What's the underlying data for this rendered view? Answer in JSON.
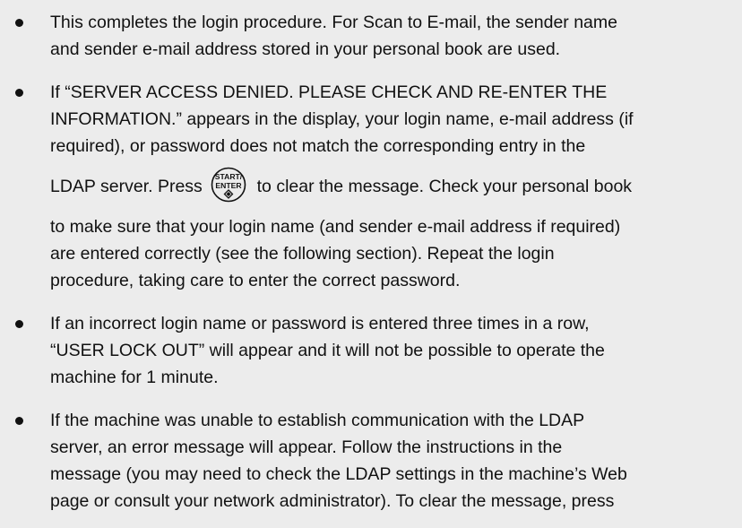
{
  "bullets": [
    {
      "lines": [
        "This completes the login procedure. For Scan to E-mail, the sender name",
        "and sender e-mail address stored in your personal book are used."
      ]
    },
    {
      "lines_before": [
        "If “SERVER ACCESS DENIED. PLEASE CHECK AND RE-ENTER THE",
        "INFORMATION.” appears in the display, your login name, e-mail address (if",
        "required), or password does not match the corresponding entry in the"
      ],
      "key_line": {
        "before": "LDAP server. Press",
        "after": "to clear the message. Check your personal book"
      },
      "lines_after": [
        "to make sure that your login name (and sender e-mail address if required)",
        "are entered correctly (see the following section). Repeat the login",
        "procedure, taking care to enter the correct password."
      ]
    },
    {
      "lines": [
        " If an incorrect login name or password is entered three times in a row,",
        "“USER LOCK OUT” will appear and it will not be possible to operate the",
        "machine for 1 minute."
      ]
    },
    {
      "lines": [
        "If the machine was unable to establish communication with the LDAP",
        "server, an error message will appear. Follow the instructions in the",
        "message (you may need to check the LDAP settings in the machine’s Web",
        "page or consult your network administrator). To clear the message, press"
      ]
    }
  ],
  "key": {
    "top_label": "START/",
    "bottom_label": "ENTER",
    "icon": "start-diamond-icon"
  }
}
